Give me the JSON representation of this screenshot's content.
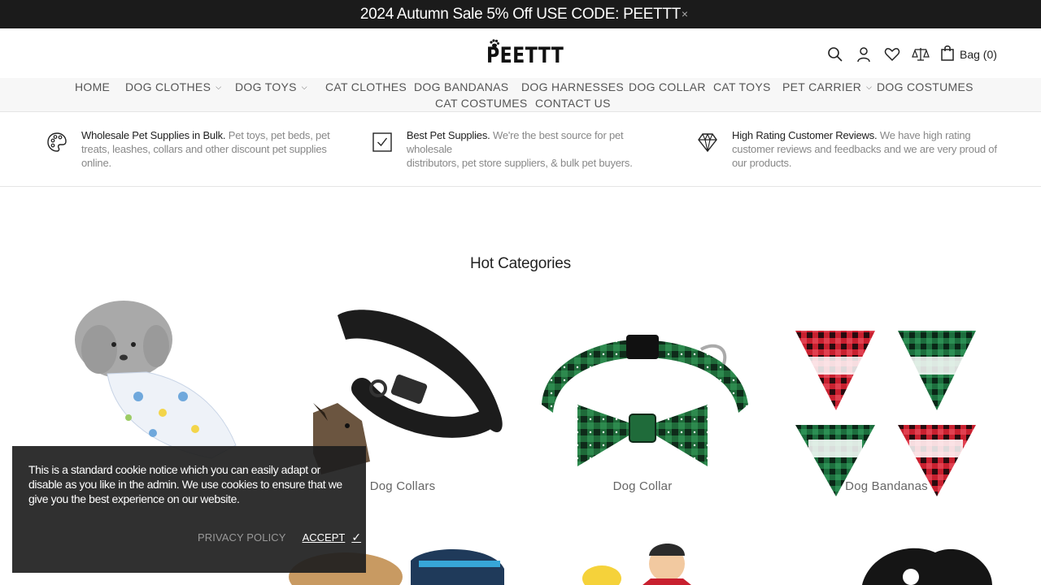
{
  "announcement": {
    "text": "2024 Autumn Sale 5% Off USE CODE: PEETTT",
    "close_glyph": "×"
  },
  "header": {
    "logo_text": "PEETTT",
    "icons": [
      "search-icon",
      "account-icon",
      "wishlist-icon",
      "compare-icon",
      "bag-icon"
    ],
    "bag_label": "Bag (0)"
  },
  "nav": {
    "items": [
      {
        "label": "HOME",
        "dropdown": false
      },
      {
        "label": "DOG CLOTHES",
        "dropdown": true
      },
      {
        "label": "DOG TOYS",
        "dropdown": true
      },
      {
        "label": "CAT CLOTHES",
        "dropdown": false
      },
      {
        "label": "DOG BANDANAS",
        "dropdown": false
      },
      {
        "label": "DOG HARNESSES",
        "dropdown": false
      },
      {
        "label": "DOG COLLAR",
        "dropdown": false
      },
      {
        "label": "CAT TOYS",
        "dropdown": false
      },
      {
        "label": "PET CARRIER",
        "dropdown": true
      },
      {
        "label": "DOG COSTUMES",
        "dropdown": false
      },
      {
        "label": "CAT COSTUMES",
        "dropdown": false
      },
      {
        "label": "CONTACT US",
        "dropdown": false
      }
    ],
    "chevron_glyph": "⌄"
  },
  "features": [
    {
      "icon": "palette-icon",
      "title": "Wholesale Pet Supplies in Bulk.",
      "line1": "Pet toys, pet beds, pet",
      "line2": "treats, leashes, collars and other discount pet supplies",
      "line3": "online."
    },
    {
      "icon": "checkbox-icon",
      "title": "Best Pet Supplies.",
      "line1": "We're the best source for pet wholesale",
      "line2": "distributors, pet store suppliers, & bulk pet buyers.",
      "line3": ""
    },
    {
      "icon": "diamond-icon",
      "title": "High Rating Customer Reviews.",
      "line1": "We have high rating",
      "line2": "customer reviews and feedbacks and we are very proud of",
      "line3": "our products."
    }
  ],
  "section": {
    "title": "Hot Categories"
  },
  "categories": [
    {
      "label": ""
    },
    {
      "label": "Dog Collars"
    },
    {
      "label": "Dog Collar"
    },
    {
      "label": "Dog Bandanas"
    }
  ],
  "cookie": {
    "line1": "This is a standard cookie notice which you can easily adapt or",
    "line2": "disable as you like in the admin. We use cookies to ensure that we",
    "line3": "give you the best experience on our website.",
    "privacy_label": "PRIVACY POLICY",
    "accept_label": "ACCEPT",
    "check_glyph": "✓"
  },
  "colors": {
    "announce_bg": "#1b1b1b",
    "nav_bg": "#f7f7f7",
    "cookie_bg": "#1e1e1e"
  }
}
